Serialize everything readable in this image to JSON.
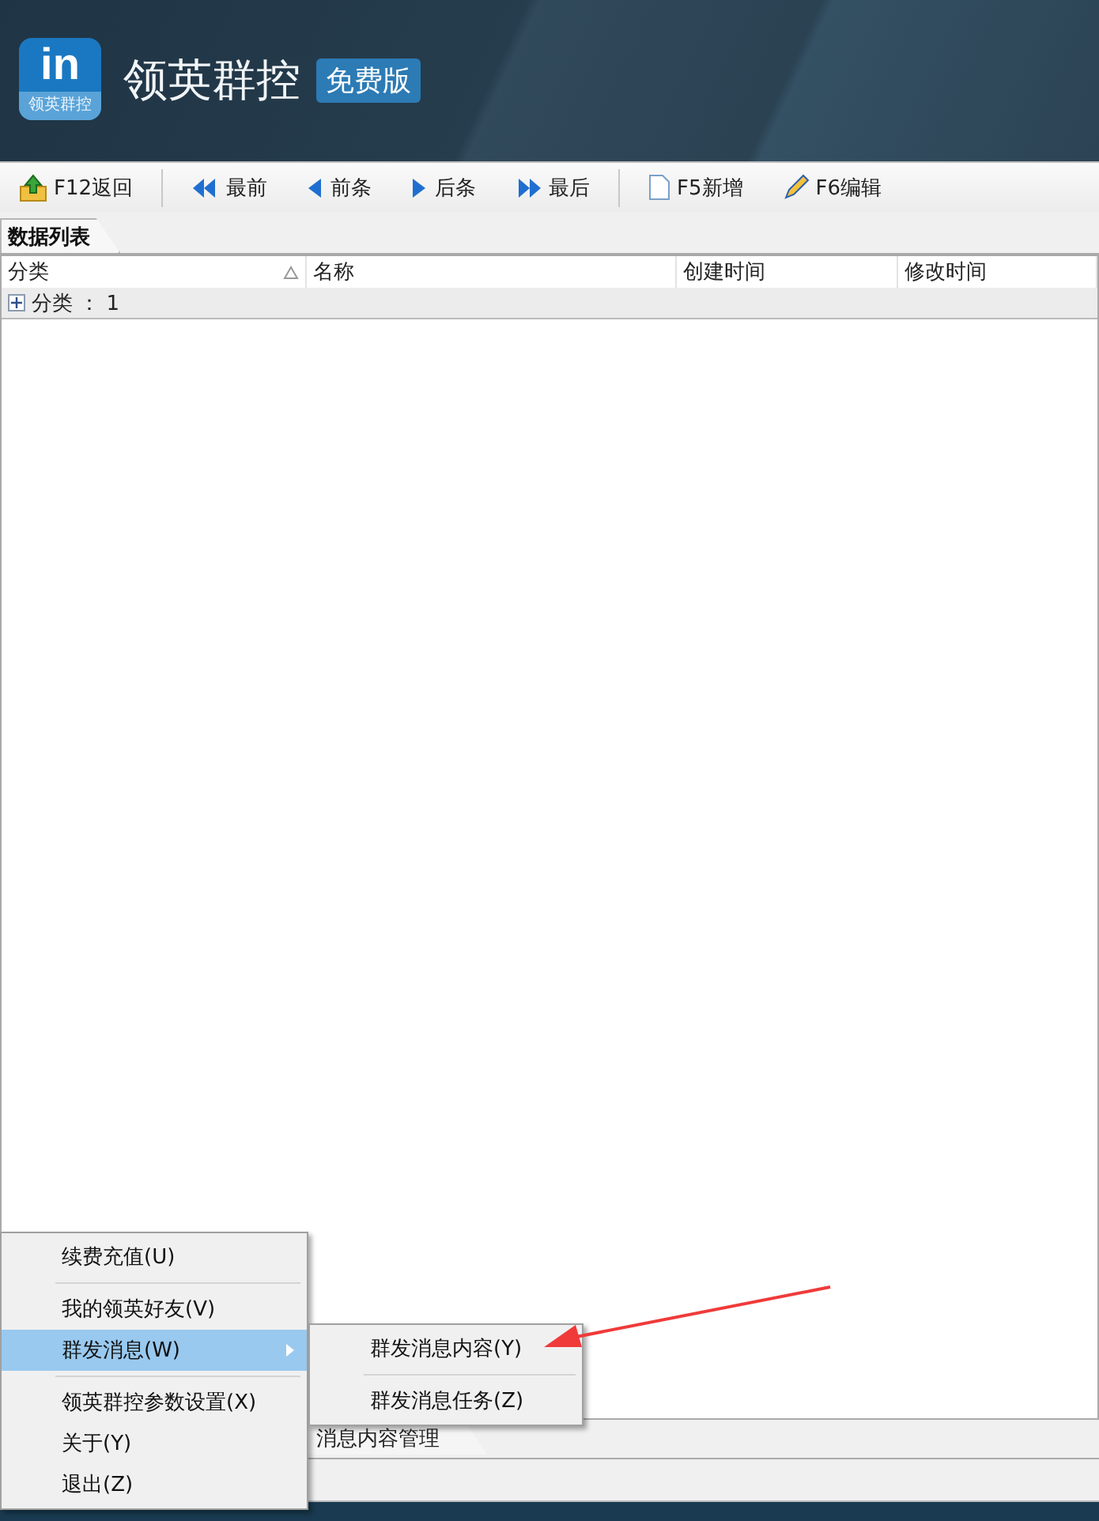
{
  "header": {
    "logo": {
      "mark": "in",
      "caption": "领英群控"
    },
    "title": "领英群控",
    "badge": "免费版"
  },
  "toolbar": [
    {
      "kind": "back",
      "label": "F12返回"
    },
    {
      "kind": "separator"
    },
    {
      "kind": "first",
      "label": "最前"
    },
    {
      "kind": "prev",
      "label": "前条"
    },
    {
      "kind": "next",
      "label": "后条"
    },
    {
      "kind": "last",
      "label": "最后"
    },
    {
      "kind": "separator"
    },
    {
      "kind": "new",
      "label": "F5新增"
    },
    {
      "kind": "edit",
      "label": "F6编辑"
    }
  ],
  "top_tabs": [
    {
      "label": "数据列表",
      "selected": true
    }
  ],
  "table": {
    "columns": [
      {
        "label": "分类",
        "sorted": true
      },
      {
        "label": "名称",
        "sorted": false
      },
      {
        "label": "创建时间",
        "sorted": false
      },
      {
        "label": "修改时间",
        "sorted": false
      }
    ],
    "group_row": {
      "label": "分类 ： 1",
      "expanded": false
    }
  },
  "bottom_tabs": [
    {
      "label": "消息内容管理",
      "selected": true
    }
  ],
  "context_menu": {
    "items": [
      {
        "kind": "item",
        "label": "续费充值(U)",
        "selected": false,
        "submenu": false
      },
      {
        "kind": "separator"
      },
      {
        "kind": "item",
        "label": "我的领英好友(V)",
        "selected": false,
        "submenu": false
      },
      {
        "kind": "item",
        "label": "群发消息(W)",
        "selected": true,
        "submenu": true
      },
      {
        "kind": "separator"
      },
      {
        "kind": "item",
        "label": "领英群控参数设置(X)",
        "selected": false,
        "submenu": false
      },
      {
        "kind": "item",
        "label": "关于(Y)",
        "selected": false,
        "submenu": false
      },
      {
        "kind": "item",
        "label": "退出(Z)",
        "selected": false,
        "submenu": false
      }
    ]
  },
  "submenu": {
    "items": [
      {
        "kind": "item",
        "label": "群发消息内容(Y)",
        "selected": false
      },
      {
        "kind": "separator"
      },
      {
        "kind": "item",
        "label": "群发消息任务(Z)",
        "selected": false
      }
    ]
  }
}
